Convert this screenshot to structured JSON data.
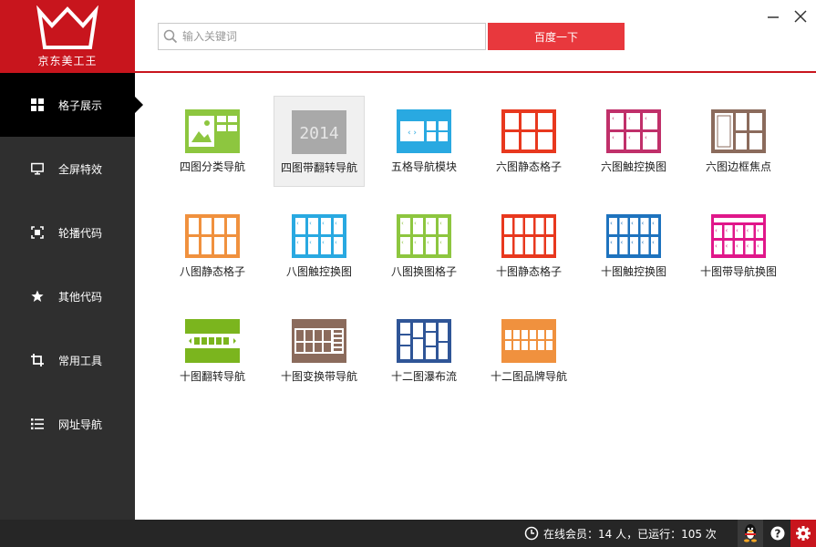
{
  "logo": {
    "text": "京东美工王"
  },
  "search": {
    "placeholder": "输入关键词",
    "button_label": "百度一下"
  },
  "sidebar": {
    "items": [
      {
        "label": "格子展示",
        "icon": "grid-icon",
        "active": true
      },
      {
        "label": "全屏特效",
        "icon": "monitor-icon",
        "active": false
      },
      {
        "label": "轮播代码",
        "icon": "focus-frame-icon",
        "active": false
      },
      {
        "label": "其他代码",
        "icon": "star-icon",
        "active": false
      },
      {
        "label": "常用工具",
        "icon": "crop-icon",
        "active": false
      },
      {
        "label": "网址导航",
        "icon": "list-icon",
        "active": false
      }
    ]
  },
  "tiles": [
    {
      "label": "四图分类导航",
      "color": "#8dc63f",
      "selected": false
    },
    {
      "label": "四图带翻转导航",
      "color": "#a9a9a9",
      "thumb_text": "2014",
      "selected": true
    },
    {
      "label": "五格导航模块",
      "color": "#29a9e1",
      "selected": false
    },
    {
      "label": "六图静态格子",
      "color": "#e8381e",
      "selected": false
    },
    {
      "label": "六图触控换图",
      "color": "#c0306a",
      "selected": false
    },
    {
      "label": "六图边框焦点",
      "color": "#8b6b5c",
      "selected": false
    },
    {
      "label": "八图静态格子",
      "color": "#f0913e",
      "selected": false
    },
    {
      "label": "八图触控换图",
      "color": "#29a9e1",
      "selected": false
    },
    {
      "label": "八图换图格子",
      "color": "#8dc63f",
      "selected": false
    },
    {
      "label": "十图静态格子",
      "color": "#e8381e",
      "selected": false
    },
    {
      "label": "十图触控换图",
      "color": "#1e73be",
      "selected": false
    },
    {
      "label": "十图带导航换图",
      "color": "#e0178a",
      "selected": false
    },
    {
      "label": "十图翻转导航",
      "color": "#7bb51e",
      "selected": false
    },
    {
      "label": "十图变换带导航",
      "color": "#8b6b5c",
      "selected": false
    },
    {
      "label": "十二图瀑布流",
      "color": "#2f5597",
      "selected": false
    },
    {
      "label": "十二图品牌导航",
      "color": "#f0913e",
      "selected": false
    }
  ],
  "status": {
    "text": "在线会员：14 人，已运行：105 次"
  },
  "colors": {
    "brand": "#c8151d",
    "sidebar_bg": "#2f2f2f",
    "statusbar_bg": "#262626",
    "button": "#e8383d"
  }
}
